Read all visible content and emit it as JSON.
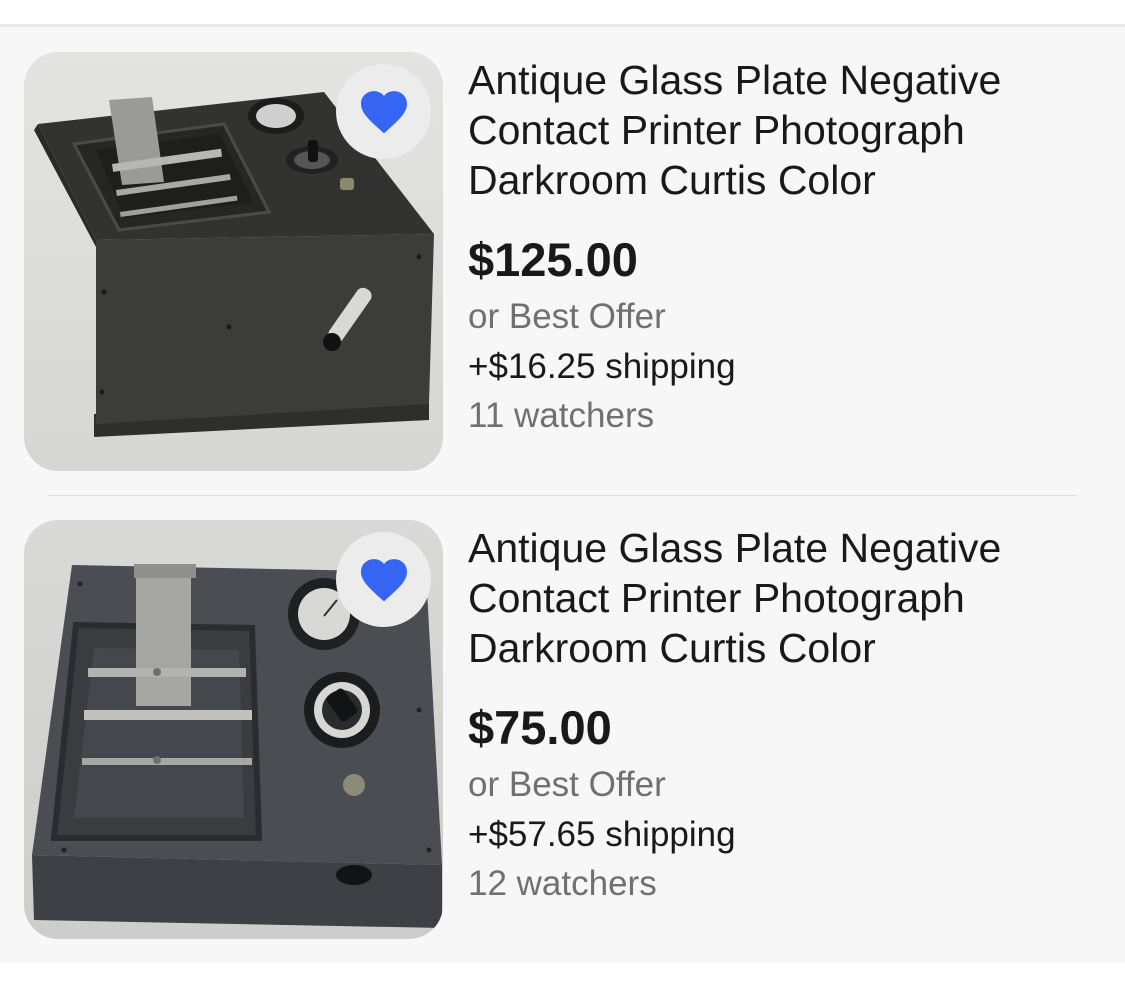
{
  "colors": {
    "heart": "#3665f3",
    "title_text": "#191919",
    "secondary_text": "#707070",
    "list_background": "#f7f7f7"
  },
  "listings": [
    {
      "title": "Antique Glass Plate Negative Contact Printer Photograph Darkroom Curtis Color",
      "price": "$125.00",
      "buying_format": "or Best Offer",
      "shipping": "+$16.25 shipping",
      "watchers": "11 watchers",
      "watched": true,
      "watch_icon": "heart-filled-icon"
    },
    {
      "title": "Antique Glass Plate Negative Contact Printer Photograph Darkroom Curtis Color",
      "price": "$75.00",
      "buying_format": "or Best Offer",
      "shipping": "+$57.65 shipping",
      "watchers": "12 watchers",
      "watched": true,
      "watch_icon": "heart-filled-icon"
    }
  ]
}
